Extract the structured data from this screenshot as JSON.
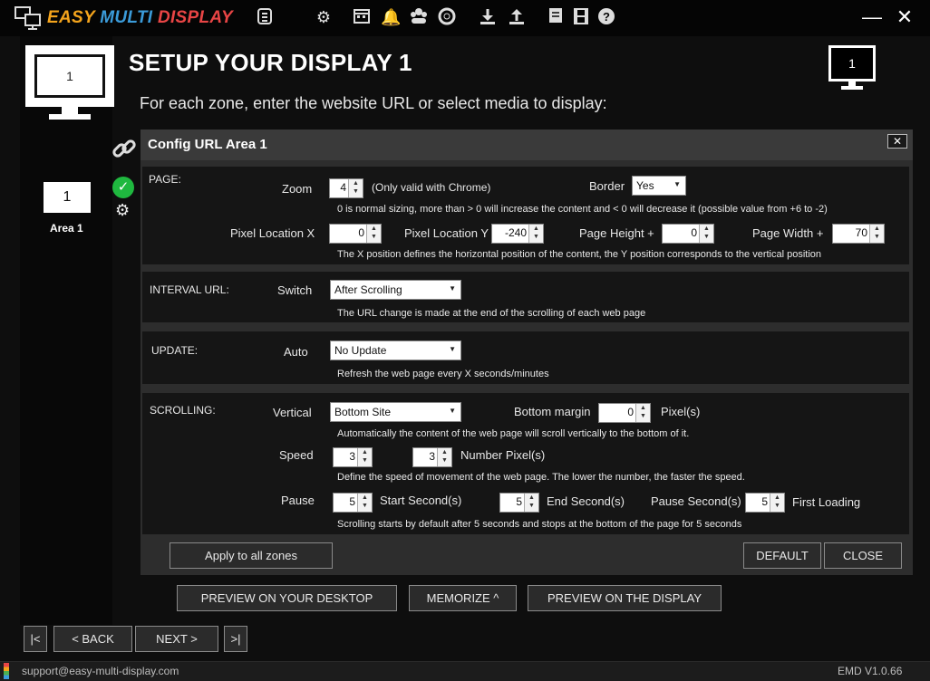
{
  "app": {
    "brand_part1": "EASY",
    "brand_part2": "MULTI",
    "brand_part3": "DISPLAY",
    "version": "EMD V1.0.66",
    "support_email": "support@easy-multi-display.com"
  },
  "toolbar_icons": [
    "plugin-icon",
    "gear-icon",
    "calendar-icon",
    "alarm-icon",
    "group-icon",
    "lifebuoy-icon",
    "download-icon",
    "upload-icon",
    "note-icon",
    "film-icon",
    "help-icon"
  ],
  "header": {
    "title": "SETUP YOUR DISPLAY 1",
    "subtitle": "For each zone, enter the website URL or select media to display:",
    "display_number": "1",
    "big_display_number": "1"
  },
  "area": {
    "number": "1",
    "label": "Area 1"
  },
  "panel": {
    "title": "Config URL Area 1",
    "close_label": "✕",
    "page": {
      "section": "PAGE:",
      "zoom_label": "Zoom",
      "zoom_value": "4",
      "zoom_note": "(Only valid with Chrome)",
      "border_label": "Border",
      "border_value": "Yes",
      "zoom_hint": "0 is normal sizing, more than > 0 will increase the content and < 0 will decrease it (possible value from +6 to -2)",
      "pixel_x_label": "Pixel Location X",
      "pixel_x_value": "0",
      "pixel_y_label": "Pixel Location Y",
      "pixel_y_value": "-240",
      "page_height_label": "Page Height +",
      "page_height_value": "0",
      "page_width_label": "Page Width +",
      "page_width_value": "70",
      "position_hint": "The X position defines the horizontal position of the content, the Y position corresponds to the vertical position"
    },
    "interval": {
      "section": "INTERVAL URL:",
      "switch_label": "Switch",
      "switch_value": "After Scrolling",
      "hint": "The URL change is made at the end of the scrolling of each web page"
    },
    "update": {
      "section": "UPDATE:",
      "auto_label": "Auto",
      "auto_value": "No Update",
      "hint": "Refresh the web page every X seconds/minutes"
    },
    "scrolling": {
      "section": "SCROLLING:",
      "vertical_label": "Vertical",
      "vertical_value": "Bottom Site",
      "bottom_margin_label": "Bottom margin",
      "bottom_margin_value": "0",
      "pixels_label": "Pixel(s)",
      "vertical_hint": "Automatically the content of the web page will scroll vertically to the bottom of it.",
      "speed_label": "Speed",
      "speed_value": "3",
      "number_pixels_value": "3",
      "number_pixels_label": "Number Pixel(s)",
      "speed_hint": "Define the speed of movement of the web page. The lower the number, the faster the speed.",
      "pause_label": "Pause",
      "start_value": "5",
      "start_label": "Start Second(s)",
      "end_value": "5",
      "end_label": "End Second(s)",
      "pause_seconds_label": "Pause Second(s)",
      "first_loading_value": "5",
      "first_loading_label": "First Loading",
      "pause_hint": "Scrolling starts by default after 5 seconds and stops at the bottom of the page for 5 seconds"
    },
    "buttons": {
      "apply_all": "Apply to all zones",
      "default": "DEFAULT",
      "close": "CLOSE"
    }
  },
  "actions": {
    "preview_desktop": "PREVIEW ON YOUR DESKTOP",
    "memorize": "MEMORIZE ^",
    "preview_display": "PREVIEW ON THE DISPLAY"
  },
  "nav": {
    "first": "|<",
    "back": "< BACK",
    "next": "NEXT >",
    "last": ">|"
  }
}
